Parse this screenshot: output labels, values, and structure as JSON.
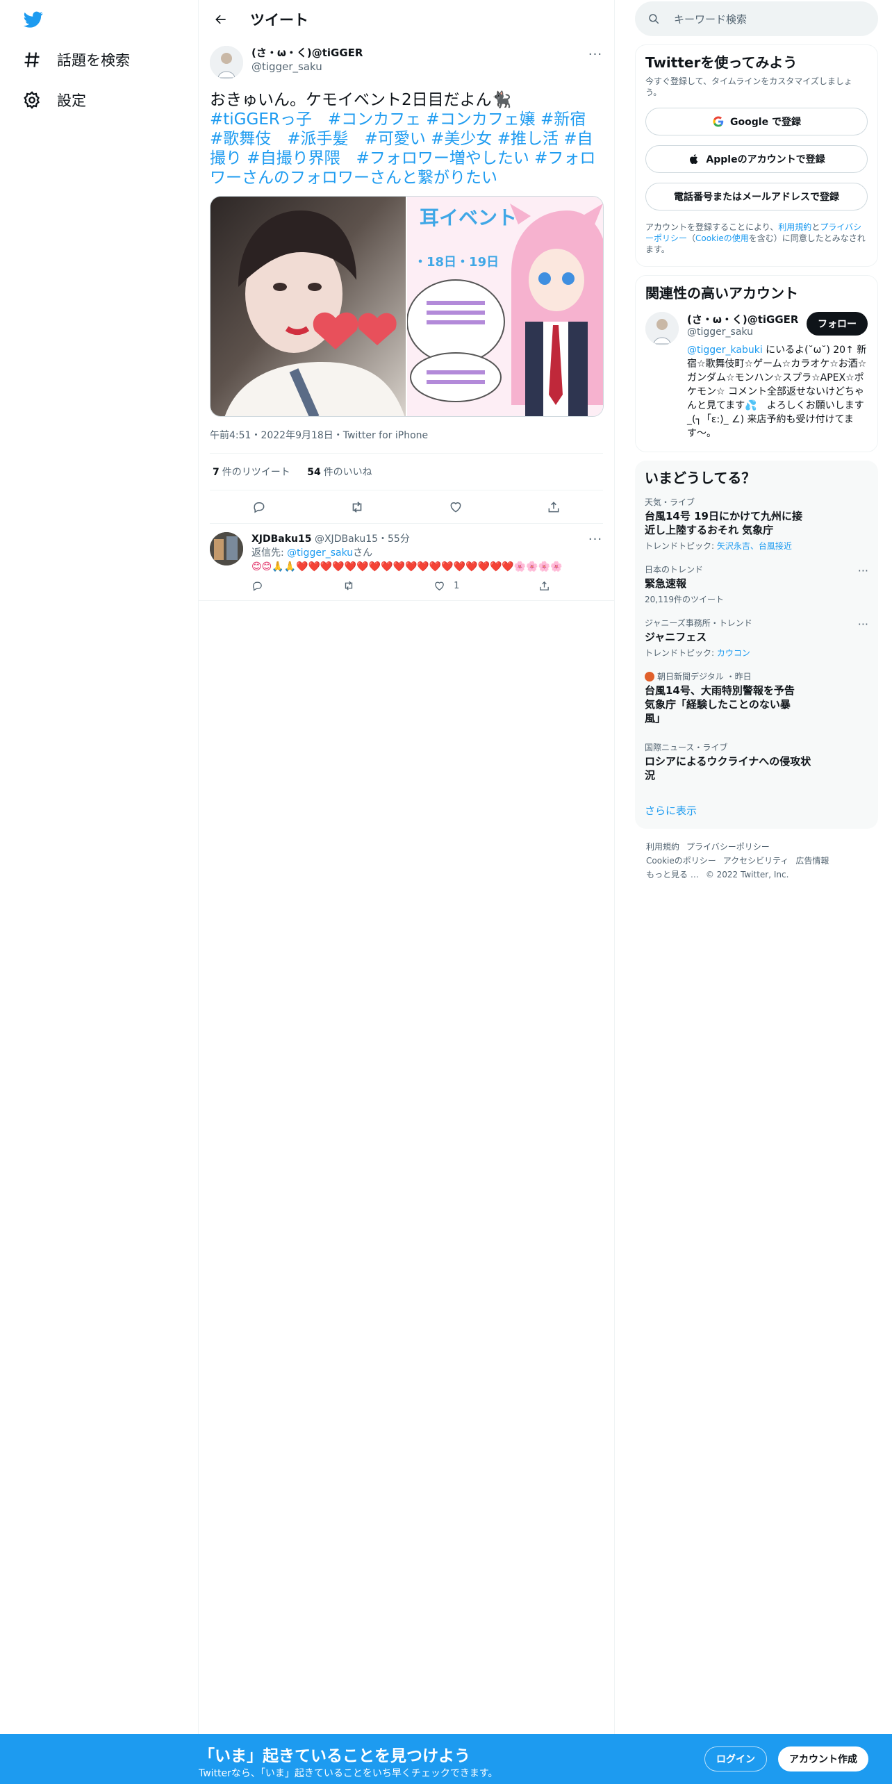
{
  "nav": {
    "items": [
      {
        "label": "話題を検索",
        "icon": "hashtag-icon"
      },
      {
        "label": "設定",
        "icon": "gear-icon"
      }
    ]
  },
  "header": {
    "title": "ツイート"
  },
  "tweet": {
    "display_name": "(さ・ω・く)@tiGGER",
    "handle": "@tigger_saku",
    "text_plain": "おきゅいん。ケモイベント2日目だよん🐈‍⬛",
    "hashtags": "#tiGGERっ子　#コンカフェ #コンカフェ嬢 #新宿 #歌舞伎　#派手髪　#可愛い #美少女 #推し活 #自撮り #自撮り界隈　#フォロワー増やしたい #フォロワーさんのフォロワーさんと繋がりたい",
    "timestamp": "午前4:51・2022年9月18日・Twitter for iPhone",
    "retweets_count": "7",
    "retweets_label": "件のリツイート",
    "likes_count": "54",
    "likes_label": "件のいいね",
    "media_text": {
      "event": "耳イベント",
      "dates": "・18日・19日"
    }
  },
  "reply": {
    "name": "XJDBaku15",
    "handle_time": "@XJDBaku15・55分",
    "reply_to_prefix": "返信先: ",
    "reply_to_handle": "@tigger_saku",
    "reply_to_suffix": "さん",
    "text": "😊😊🙏🙏❤️❤️❤️❤️❤️❤️❤️❤️❤️❤️❤️❤️❤️❤️❤️❤️❤️❤️🌸🌸🌸🌸",
    "like_count": "1"
  },
  "right": {
    "search_placeholder": "キーワード検索",
    "signup": {
      "title": "Twitterを使ってみよう",
      "subtitle": "今すぐ登録して、タイムラインをカスタマイズしましょう。",
      "google": "Google で登録",
      "apple": "Appleのアカウントで登録",
      "phone": "電話番号またはメールアドレスで登録",
      "legal_1": "アカウントを登録することにより、",
      "legal_terms": "利用規約",
      "legal_2": "と",
      "legal_privacy": "プライバシーポリシー",
      "legal_3": "（",
      "legal_cookie": "Cookieの使用",
      "legal_4": "を含む）に同意したとみなされます。"
    },
    "related": {
      "title": "関連性の高いアカウント",
      "name": "(さ・ω・く)@tiGGER",
      "handle": "@tigger_saku",
      "follow": "フォロー",
      "bio_link": "@tigger_kabuki",
      "bio": " にいるよ(˘ω˘) 20↑ 新宿☆歌舞伎町☆ゲーム☆カラオケ☆お酒☆ガンダム☆モンハン☆スプラ☆APEX☆ポケモン☆ コメント全部返せないけどちゃんと見てます💦　よろしくお願いします_(┐「ε:)_ ∠) 来店予約も受け付けてます〜。"
    },
    "trends": {
      "title": "いまどうしてる？",
      "items": [
        {
          "cat": "天気・ライブ",
          "title": "台風14号 19日にかけて九州に接近し上陸するおそれ 気象庁",
          "ex_label": "トレンドトピック: ",
          "ex_value": "矢沢永吉、台風接近"
        },
        {
          "cat": "日本のトレンド",
          "title": "緊急速報",
          "ex_plain": "20,119件のツイート"
        },
        {
          "cat": "ジャニーズ事務所・トレンド",
          "title": "ジャニフェス",
          "ex_label": "トレンドトピック: ",
          "ex_value": "カウコン"
        },
        {
          "cat": "朝日新聞デジタル ・昨日",
          "title": "台風14号、大雨特別警報を予告 気象庁「経験したことのない暴風」"
        },
        {
          "cat": "国際ニュース・ライブ",
          "title": "ロシアによるウクライナへの侵攻状況"
        }
      ],
      "show_more": "さらに表示"
    },
    "footer": {
      "line1": [
        "利用規約",
        "プライバシーポリシー"
      ],
      "line2": [
        "Cookieのポリシー",
        "アクセシビリティ",
        "広告情報"
      ],
      "line3": [
        "もっと見る …",
        "© 2022 Twitter, Inc."
      ]
    }
  },
  "bottom": {
    "headline": "「いま」起きていることを見つけよう",
    "sub": "Twitterなら、「いま」起きていることをいち早くチェックできます。",
    "login": "ログイン",
    "signup": "アカウント作成"
  },
  "colors": {
    "accent": "#1d9bf0",
    "text": "#0f1419",
    "muted": "#536471",
    "border": "#eff3f4"
  }
}
